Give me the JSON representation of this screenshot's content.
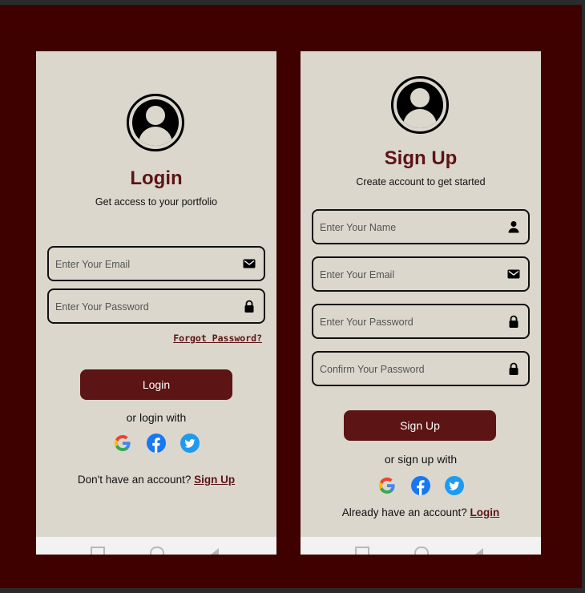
{
  "login": {
    "title": "Login",
    "subtitle": "Get access to your portfolio",
    "email_placeholder": "Enter Your Email",
    "password_placeholder": "Enter Your Password",
    "forgot_label": "Forgot Password?",
    "button_label": "Login",
    "or_label": "or login with",
    "footer_text": "Don't have an account? ",
    "footer_link": "Sign Up"
  },
  "signup": {
    "title": "Sign Up",
    "subtitle": "Create account to get started",
    "name_placeholder": "Enter Your Name",
    "email_placeholder": "Enter Your Email",
    "password_placeholder": "Enter Your Password",
    "confirm_placeholder": "Confirm Your Password",
    "button_label": "Sign Up",
    "or_label": "or sign up with",
    "footer_text": "Already have an account? ",
    "footer_link": "Login"
  },
  "icons": [
    "user-avatar-icon",
    "mail-icon",
    "lock-icon",
    "person-icon",
    "google-icon",
    "facebook-icon",
    "twitter-icon"
  ],
  "colors": {
    "frame": "#3f0000",
    "screen": "#dbd7cd",
    "accent": "#5c1414",
    "facebook": "#1877f2",
    "twitter": "#1d9bf0"
  }
}
